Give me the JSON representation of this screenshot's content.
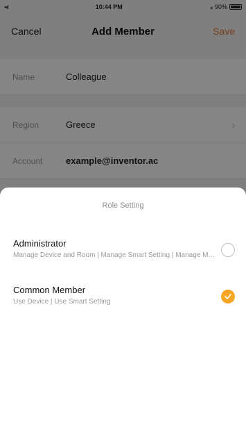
{
  "status_bar": {
    "signal": "••ıl",
    "time": "10:44 PM",
    "battery_text": "⁎ 90%"
  },
  "nav": {
    "cancel_label": "Cancel",
    "title": "Add Member",
    "save_label": "Save"
  },
  "form": {
    "name_label": "Name",
    "name_value": "Colleague",
    "region_label": "Region",
    "region_value": "Greece",
    "account_label": "Account",
    "account_value": "example@inventor.ac"
  },
  "role_sheet": {
    "title": "Role Setting",
    "options": [
      {
        "title": "Administrator",
        "description": "Manage Device and Room | Manage Smart Setting | Manage Members",
        "selected": false
      },
      {
        "title": "Common Member",
        "description": "Use Device | Use Smart Setting",
        "selected": true
      }
    ]
  },
  "colors": {
    "accent": "#f6a623",
    "save": "#e8792b"
  }
}
